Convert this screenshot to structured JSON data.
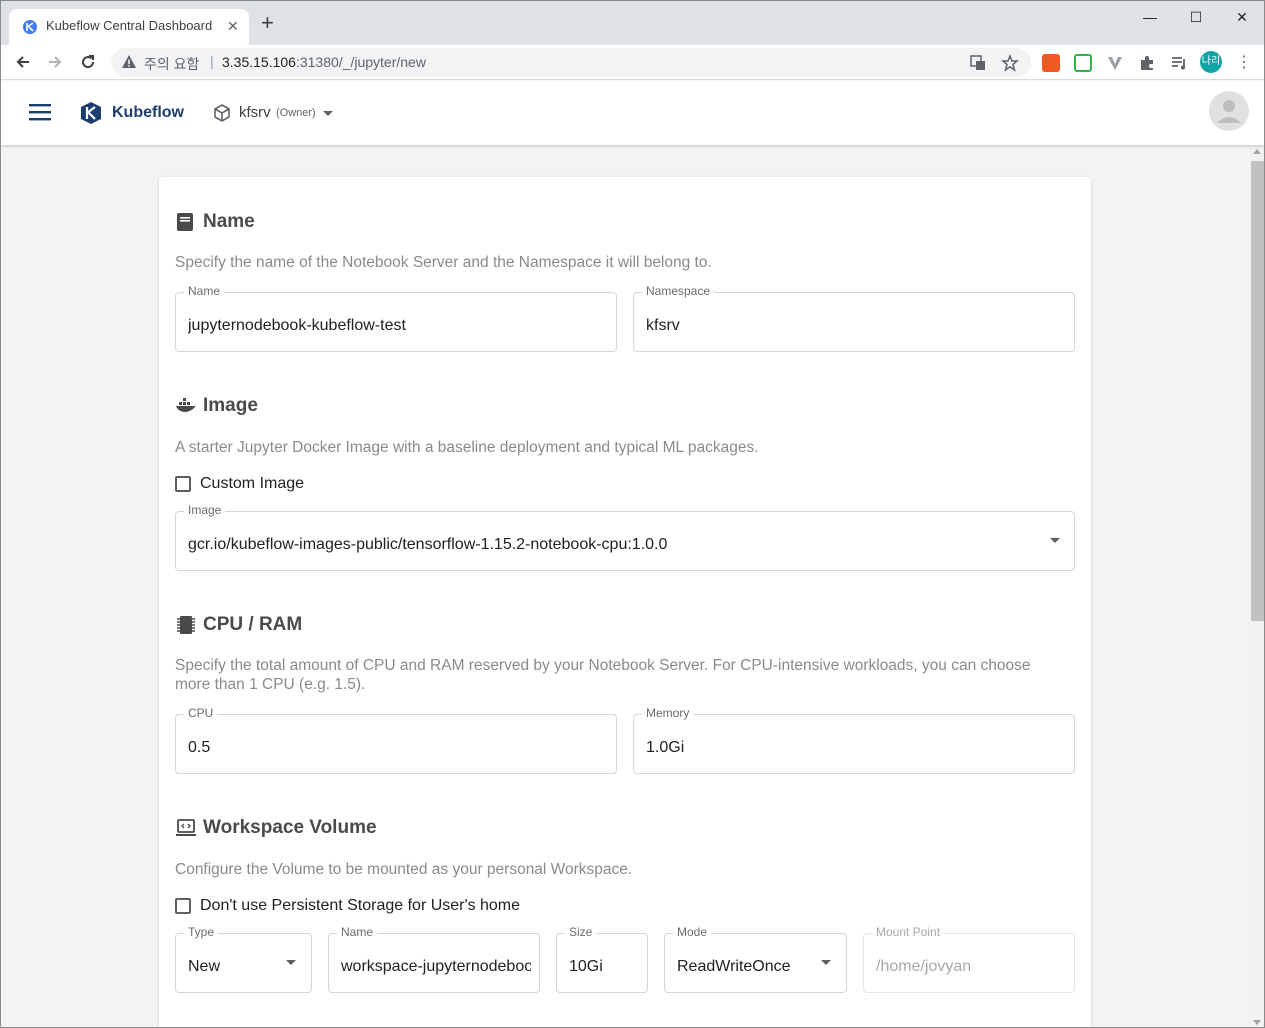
{
  "browser": {
    "tab_title": "Kubeflow Central Dashboard",
    "security_label": "주의 요함",
    "url_host": "3.35.15.106",
    "url_rest": ":31380/_/jupyter/new",
    "profile_initials": "나리"
  },
  "header": {
    "brand": "Kubeflow",
    "namespace": "kfsrv",
    "namespace_role": "(Owner)"
  },
  "form": {
    "name_section": {
      "title": "Name",
      "description": "Specify the name of the Notebook Server and the Namespace it will belong to.",
      "name_label": "Name",
      "name_value": "jupyternodebook-kubeflow-test",
      "namespace_label": "Namespace",
      "namespace_value": "kfsrv"
    },
    "image_section": {
      "title": "Image",
      "description": "A starter Jupyter Docker Image with a baseline deployment and typical ML packages.",
      "custom_image_label": "Custom Image",
      "custom_image_checked": false,
      "image_label": "Image",
      "image_value": "gcr.io/kubeflow-images-public/tensorflow-1.15.2-notebook-cpu:1.0.0"
    },
    "cpu_section": {
      "title": "CPU / RAM",
      "description": "Specify the total amount of CPU and RAM reserved by your Notebook Server. For CPU-intensive workloads, you can choose more than 1 CPU (e.g. 1.5).",
      "cpu_label": "CPU",
      "cpu_value": "0.5",
      "memory_label": "Memory",
      "memory_value": "1.0Gi"
    },
    "workspace_section": {
      "title": "Workspace Volume",
      "description": "Configure the Volume to be mounted as your personal Workspace.",
      "no_persistent_label": "Don't use Persistent Storage for User's home",
      "no_persistent_checked": false,
      "type_label": "Type",
      "type_value": "New",
      "name_label": "Name",
      "name_value": "workspace-jupyternodebook-kubeflow-test",
      "size_label": "Size",
      "size_value": "10Gi",
      "mode_label": "Mode",
      "mode_value": "ReadWriteOnce",
      "mount_label": "Mount Point",
      "mount_value": "/home/jovyan"
    }
  },
  "colors": {
    "accent": "#1a3f6f",
    "page_bg": "#f1f3f4",
    "section_title": "#4a4a4a",
    "description": "#8a8a8a"
  }
}
